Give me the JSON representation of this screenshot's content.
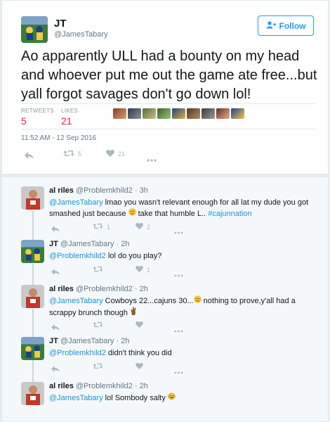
{
  "main_tweet": {
    "name": "JT",
    "handle": "@JamesTabary",
    "follow_label": "Follow",
    "text": "Ao apparently ULL had a bounty on my head and whoever put me out the game ate free...but yall forgot savages don't go down lol!",
    "retweets_label": "RETWEETS",
    "retweets_count": "5",
    "likes_label": "LIKES",
    "likes_count": "21",
    "timestamp": "11:52 AM - 12 Sep 2016",
    "action_retweets": "5",
    "action_likes": "21"
  },
  "replies": [
    {
      "name": "al riles",
      "handle": "@Problemkhild2",
      "time": "3h",
      "mention": "@JamesTabary",
      "text1": " lmao you wasn't  relevant enough for all lat my dude you got smashed just because ",
      "text2": " take that humble L.. ",
      "hashtag": "#cajunnation",
      "retweets": "1",
      "likes": "2"
    },
    {
      "name": "JT",
      "handle": "@JamesTabary",
      "time": "2h",
      "mention": "@Problemkhild2",
      "text1": " lol do you play?",
      "retweets": "",
      "likes": "1"
    },
    {
      "name": "al riles",
      "handle": "@Problemkhild2",
      "time": "2h",
      "mention": "@JamesTabary",
      "text1": " Cowboys 22...cajuns 30...",
      "text2": " nothing to prove,y'all had a scrappy brunch though ",
      "retweets": "",
      "likes": ""
    },
    {
      "name": "JT",
      "handle": "@JamesTabary",
      "time": "2h",
      "mention": "@Problemkhild2",
      "text1": " didn't think you did",
      "retweets": "",
      "likes": ""
    },
    {
      "name": "al riles",
      "handle": "@Problemkhild2",
      "time": "2h",
      "mention": "@JamesTabary",
      "text1": " lol Sombody salty ",
      "retweets": "",
      "likes": ""
    }
  ],
  "separator": "·",
  "icons": [
    "reply-icon",
    "retweet-icon",
    "heart-icon",
    "more-icon",
    "add-user-icon",
    "thinking-emoji",
    "ok-hand-emoji",
    "laughing-emoji"
  ],
  "colors": {
    "link": "#1b95e0",
    "likes": "#e0245e",
    "follow": "#1da1f2"
  }
}
